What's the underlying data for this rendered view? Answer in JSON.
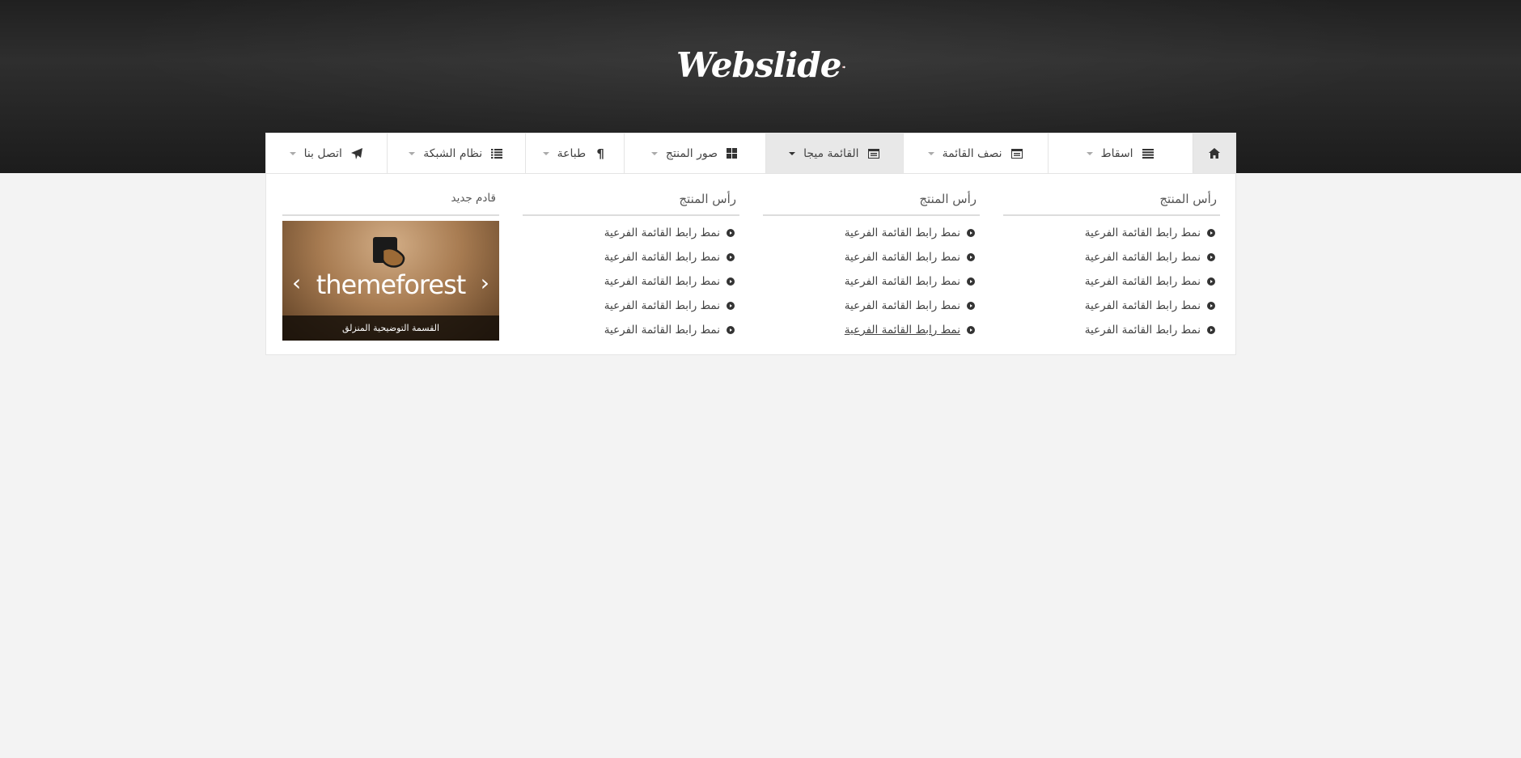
{
  "brand": {
    "logo_text": "Webslide"
  },
  "menu": {
    "items": [
      {
        "label": "",
        "icon": "home-icon"
      },
      {
        "label": "اسقاط",
        "icon": "list-icon"
      },
      {
        "label": "نصف القائمة",
        "icon": "window-icon"
      },
      {
        "label": "القائمة ميجا",
        "icon": "window-icon",
        "active": true
      },
      {
        "label": "صور المنتج",
        "icon": "grid-icon"
      },
      {
        "label": "طباعة",
        "icon": "paragraph-icon"
      },
      {
        "label": "نظام الشبكة",
        "icon": "list-ul-icon"
      },
      {
        "label": "اتصل بنا",
        "icon": "paper-plane-icon"
      }
    ]
  },
  "mega": {
    "columns": [
      {
        "title": "رأس المنتج",
        "links": [
          "نمط رابط القائمة الفرعية",
          "نمط رابط القائمة الفرعية",
          "نمط رابط القائمة الفرعية",
          "نمط رابط القائمة الفرعية",
          "نمط رابط القائمة الفرعية"
        ]
      },
      {
        "title": "رأس المنتج",
        "links": [
          "نمط رابط القائمة الفرعية",
          "نمط رابط القائمة الفرعية",
          "نمط رابط القائمة الفرعية",
          "نمط رابط القائمة الفرعية",
          "نمط رابط القائمة الفرعية"
        ]
      },
      {
        "title": "رأس المنتج",
        "links": [
          "نمط رابط القائمة الفرعية",
          "نمط رابط القائمة الفرعية",
          "نمط رابط القائمة الفرعية",
          "نمط رابط القائمة الفرعية",
          "نمط رابط القائمة الفرعية"
        ]
      }
    ],
    "featured": {
      "title": "قادم جديد",
      "banner_text": "themeforest",
      "caption": "القسمة التوضيحية المنزلق"
    }
  },
  "colors": {
    "header_bg": "#1f1f1f",
    "active_tab": "#e8e8e8",
    "page_bg": "#f3f3f3"
  }
}
